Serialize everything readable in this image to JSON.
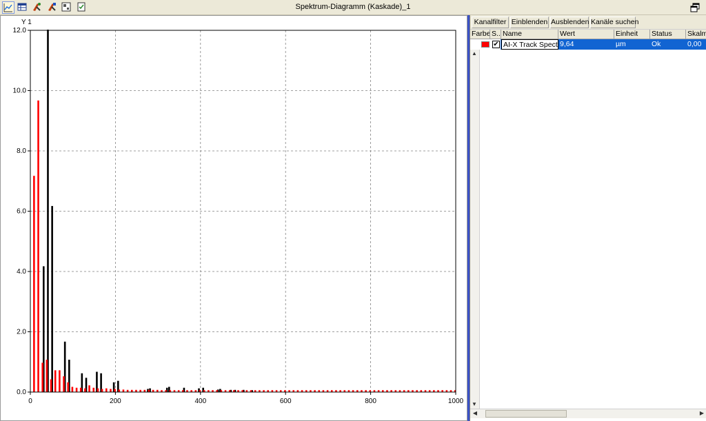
{
  "window": {
    "title": "Spektrum-Diagramm (Kaskade)_1"
  },
  "toolbar": {
    "icons": [
      "chart-view-icon",
      "table-view-icon",
      "cursor-tool-icon",
      "cursor-settings-icon",
      "layout-icon",
      "export-icon"
    ],
    "restore_icon": "window-restore-icon"
  },
  "right_panel": {
    "buttons": [
      "Kanalfilter",
      "Einblenden",
      "Ausblenden",
      "Kanäle suchen"
    ],
    "columns": [
      "Farbe",
      "S..",
      "Name",
      "Wert",
      "Einheit",
      "Status",
      "Skalmi"
    ],
    "rows": [
      {
        "color": "#ff0000",
        "checked": true,
        "name": "AI-X Track Spectrum",
        "value": "9,64",
        "unit": "µm",
        "status": "Ok",
        "scale_min": "0,00"
      }
    ]
  },
  "chart_data": {
    "type": "bar",
    "title": "",
    "xlabel": "",
    "ylabel": "Y 1",
    "xlim": [
      0,
      1000
    ],
    "ylim": [
      0,
      12
    ],
    "x_ticks": [
      "0",
      "200",
      "400",
      "600",
      "800",
      "1000"
    ],
    "y_ticks": [
      "0.0",
      "2.0",
      "4.0",
      "6.0",
      "8.0",
      "10.0",
      "12.0"
    ],
    "grid": true,
    "series": [
      {
        "color": "#000000",
        "x": [
          30,
          40,
          50,
          80,
          90,
          120,
          130,
          155,
          165,
          195,
          205,
          275,
          280,
          320,
          325,
          360,
          395,
          405,
          440,
          445,
          470,
          480,
          500,
          520
        ],
        "values": [
          4.15,
          12.0,
          6.15,
          1.65,
          1.05,
          0.6,
          0.45,
          0.65,
          0.6,
          0.3,
          0.35,
          0.08,
          0.1,
          0.12,
          0.15,
          0.12,
          0.1,
          0.12,
          0.06,
          0.08,
          0.05,
          0.05,
          0.05,
          0.04
        ]
      },
      {
        "color": "#ff0000",
        "x": [
          10,
          20,
          30,
          40,
          50,
          60,
          70,
          80,
          90,
          100,
          110,
          120,
          130,
          140,
          150,
          160,
          170,
          180,
          190,
          200,
          210,
          220,
          230,
          240,
          250,
          260,
          270,
          280,
          290,
          300,
          310,
          320,
          330,
          340,
          350,
          360,
          370,
          380,
          390,
          400,
          410,
          420,
          430,
          440,
          450,
          460,
          470,
          480,
          490,
          500,
          510,
          520,
          530,
          540,
          550,
          560,
          570,
          580,
          590,
          600,
          610,
          620,
          630,
          640,
          650,
          660,
          670,
          680,
          690,
          700,
          710,
          720,
          730,
          740,
          750,
          760,
          770,
          780,
          790,
          800,
          810,
          820,
          830,
          840,
          850,
          860,
          870,
          880,
          890,
          900,
          910,
          920,
          930,
          940,
          950,
          960,
          970,
          980,
          990,
          1000
        ],
        "values": [
          7.15,
          9.65,
          0.95,
          1.05,
          0.4,
          0.7,
          0.7,
          0.5,
          0.3,
          0.15,
          0.12,
          0.12,
          0.1,
          0.2,
          0.12,
          0.1,
          0.08,
          0.1,
          0.08,
          0.08,
          0.06,
          0.06,
          0.05,
          0.05,
          0.05,
          0.05,
          0.05,
          0.05,
          0.05,
          0.05,
          0.04,
          0.04,
          0.04,
          0.04,
          0.04,
          0.04,
          0.04,
          0.04,
          0.04,
          0.04,
          0.04,
          0.04,
          0.04,
          0.04,
          0.04,
          0.04,
          0.04,
          0.04,
          0.04,
          0.04,
          0.04,
          0.04,
          0.04,
          0.04,
          0.04,
          0.04,
          0.04,
          0.04,
          0.04,
          0.04,
          0.04,
          0.04,
          0.04,
          0.04,
          0.04,
          0.04,
          0.04,
          0.04,
          0.04,
          0.04,
          0.04,
          0.04,
          0.04,
          0.04,
          0.04,
          0.04,
          0.04,
          0.04,
          0.04,
          0.04,
          0.04,
          0.04,
          0.04,
          0.04,
          0.04,
          0.04,
          0.04,
          0.04,
          0.04,
          0.04,
          0.04,
          0.04,
          0.04,
          0.04,
          0.04,
          0.04,
          0.04,
          0.04,
          0.04,
          0.04
        ]
      }
    ]
  }
}
